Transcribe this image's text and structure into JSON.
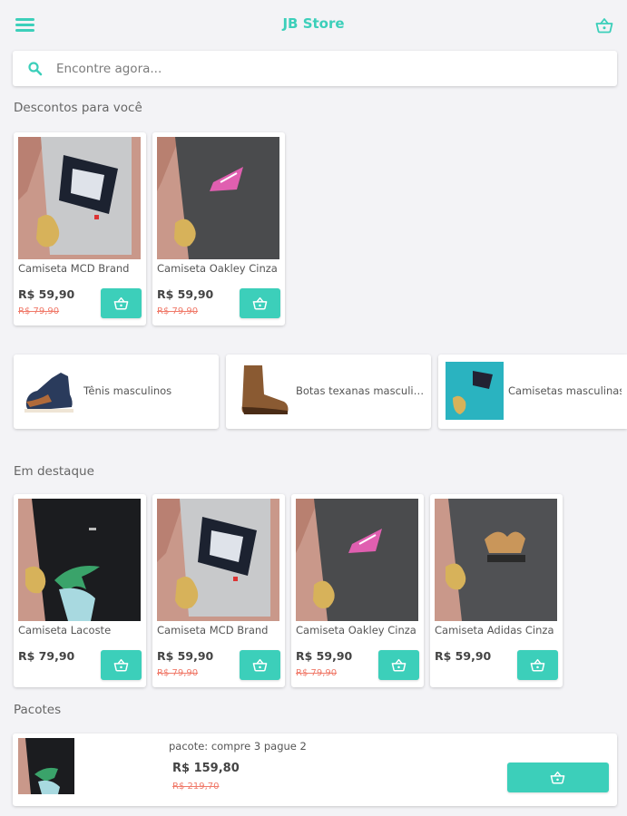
{
  "header": {
    "title": "JB Store",
    "menu_icon": "menu-icon",
    "cart_icon": "basket-icon"
  },
  "search": {
    "placeholder": "Encontre agora..."
  },
  "colors": {
    "accent": "#3ccfba",
    "old_price": "#f07a6a",
    "background": "#f3f3f6"
  },
  "discounts": {
    "title": "Descontos para você",
    "items": [
      {
        "name": "Camiseta MCD Brand",
        "price": "R$ 59,90",
        "old_price": "R$ 79,90"
      },
      {
        "name": "Camiseta Oakley Cinza",
        "price": "R$ 59,90",
        "old_price": "R$ 79,90"
      }
    ]
  },
  "categories": [
    {
      "label": "Tênis masculinos"
    },
    {
      "label": "Botas texanas masculinas"
    },
    {
      "label": "Camisetas masculinas"
    }
  ],
  "featured": {
    "title": "Em destaque",
    "items": [
      {
        "name": "Camiseta Lacoste",
        "price": "R$ 79,90"
      },
      {
        "name": "Camiseta MCD Brand",
        "price": "R$ 59,90",
        "old_price": "R$ 79,90"
      },
      {
        "name": "Camiseta Oakley Cinza",
        "price": "R$ 59,90",
        "old_price": "R$ 79,90"
      },
      {
        "name": "Camiseta Adidas Cinza",
        "price": "R$ 59,90"
      }
    ]
  },
  "bundles": {
    "title": "Pacotes",
    "items": [
      {
        "name": "pacote: compre 3 pague 2",
        "price": "R$ 159,80",
        "old_price": "R$ 219,70"
      }
    ]
  }
}
